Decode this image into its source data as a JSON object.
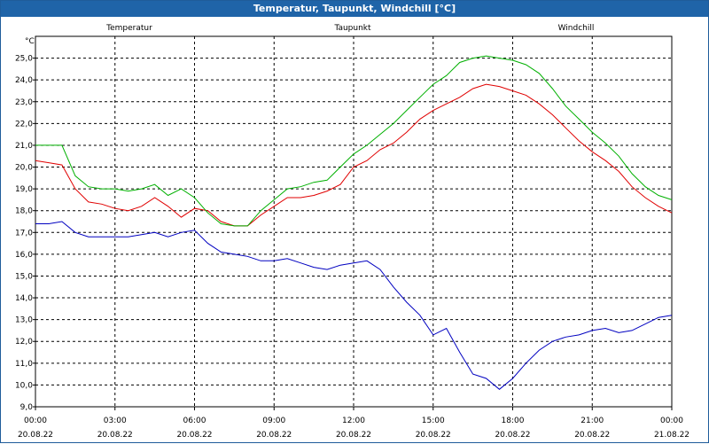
{
  "title": "Temperatur, Taupunkt, Windchill [°C]",
  "colors": {
    "titlebar": "#1f64a8",
    "grid": "#000000",
    "axis": "#000000"
  },
  "chart_data": {
    "type": "line",
    "title": "Temperatur, Taupunkt, Windchill [°C]",
    "yunit": "°C",
    "ylim": [
      9.0,
      26.0
    ],
    "y_ticks": [
      "9,0",
      "10,0",
      "11,0",
      "12,0",
      "13,0",
      "14,0",
      "15,0",
      "16,0",
      "17,0",
      "18,0",
      "19,0",
      "20,0",
      "21,0",
      "22,0",
      "23,0",
      "24,0",
      "25,0"
    ],
    "x_ticks": [
      {
        "time": "00:00",
        "date": "20.08.22"
      },
      {
        "time": "03:00",
        "date": "20.08.22"
      },
      {
        "time": "06:00",
        "date": "20.08.22"
      },
      {
        "time": "09:00",
        "date": "20.08.22"
      },
      {
        "time": "12:00",
        "date": "20.08.22"
      },
      {
        "time": "15:00",
        "date": "20.08.22"
      },
      {
        "time": "18:00",
        "date": "20.08.22"
      },
      {
        "time": "21:00",
        "date": "20.08.22"
      },
      {
        "time": "00:00",
        "date": "21.08.22"
      }
    ],
    "x_hours_range": [
      0,
      24
    ],
    "grid": true,
    "series": [
      {
        "name": "Temperatur",
        "color": "#e00000",
        "x": [
          0,
          0.5,
          1,
          1.5,
          2,
          2.5,
          3,
          3.5,
          4,
          4.5,
          5,
          5.5,
          6,
          6.5,
          7,
          7.5,
          8,
          8.5,
          9,
          9.5,
          10,
          10.5,
          11,
          11.5,
          12,
          12.5,
          13,
          13.5,
          14,
          14.5,
          15,
          15.5,
          16,
          16.5,
          17,
          17.5,
          18,
          18.5,
          19,
          19.5,
          20,
          20.5,
          21,
          21.5,
          22,
          22.5,
          23,
          23.5,
          24
        ],
        "y": [
          20.3,
          20.2,
          20.1,
          19.0,
          18.4,
          18.3,
          18.1,
          18.0,
          18.2,
          18.6,
          18.2,
          17.7,
          18.1,
          18.0,
          17.5,
          17.3,
          17.3,
          17.8,
          18.2,
          18.6,
          18.6,
          18.7,
          18.9,
          19.2,
          20.0,
          20.3,
          20.8,
          21.1,
          21.6,
          22.2,
          22.6,
          22.9,
          23.2,
          23.6,
          23.8,
          23.7,
          23.5,
          23.3,
          22.9,
          22.4,
          21.8,
          21.2,
          20.7,
          20.3,
          19.8,
          19.1,
          18.6,
          18.2,
          17.9
        ]
      },
      {
        "name": "Taupunkt",
        "color": "#0000c0",
        "x": [
          0,
          0.5,
          1,
          1.5,
          2,
          2.5,
          3,
          3.5,
          4,
          4.5,
          5,
          5.5,
          6,
          6.5,
          7,
          7.5,
          8,
          8.5,
          9,
          9.5,
          10,
          10.5,
          11,
          11.5,
          12,
          12.5,
          13,
          13.5,
          14,
          14.5,
          15,
          15.5,
          16,
          16.5,
          17,
          17.5,
          18,
          18.5,
          19,
          19.5,
          20,
          20.5,
          21,
          21.5,
          22,
          22.5,
          23,
          23.5,
          24
        ],
        "y": [
          17.4,
          17.4,
          17.5,
          17.0,
          16.8,
          16.8,
          16.8,
          16.8,
          16.9,
          17.0,
          16.8,
          17.0,
          17.1,
          16.5,
          16.1,
          16.0,
          15.9,
          15.7,
          15.7,
          15.8,
          15.6,
          15.4,
          15.3,
          15.5,
          15.6,
          15.7,
          15.3,
          14.5,
          13.8,
          13.2,
          12.3,
          12.6,
          11.5,
          10.5,
          10.3,
          9.8,
          10.3,
          11.0,
          11.6,
          12.0,
          12.2,
          12.3,
          12.5,
          12.6,
          12.4,
          12.5,
          12.8,
          13.1,
          13.2
        ]
      },
      {
        "name": "Windchill",
        "color": "#00b000",
        "x": [
          0,
          0.5,
          1,
          1.5,
          2,
          2.5,
          3,
          3.5,
          4,
          4.5,
          5,
          5.5,
          6,
          6.5,
          7,
          7.5,
          8,
          8.5,
          9,
          9.5,
          10,
          10.5,
          11,
          11.5,
          12,
          12.5,
          13,
          13.5,
          14,
          14.5,
          15,
          15.5,
          16,
          16.5,
          17,
          17.5,
          18,
          18.5,
          19,
          19.5,
          20,
          20.5,
          21,
          21.5,
          22,
          22.5,
          23,
          23.5,
          24
        ],
        "y": [
          21.0,
          21.0,
          21.0,
          19.6,
          19.1,
          19.0,
          19.0,
          18.9,
          19.0,
          19.2,
          18.7,
          19.0,
          18.6,
          17.9,
          17.4,
          17.3,
          17.3,
          18.0,
          18.5,
          19.0,
          19.1,
          19.3,
          19.4,
          20.0,
          20.6,
          21.0,
          21.5,
          22.0,
          22.6,
          23.2,
          23.8,
          24.2,
          24.8,
          25.0,
          25.1,
          25.0,
          24.9,
          24.7,
          24.3,
          23.6,
          22.8,
          22.2,
          21.6,
          21.1,
          20.5,
          19.7,
          19.1,
          18.7,
          18.5
        ]
      }
    ]
  }
}
